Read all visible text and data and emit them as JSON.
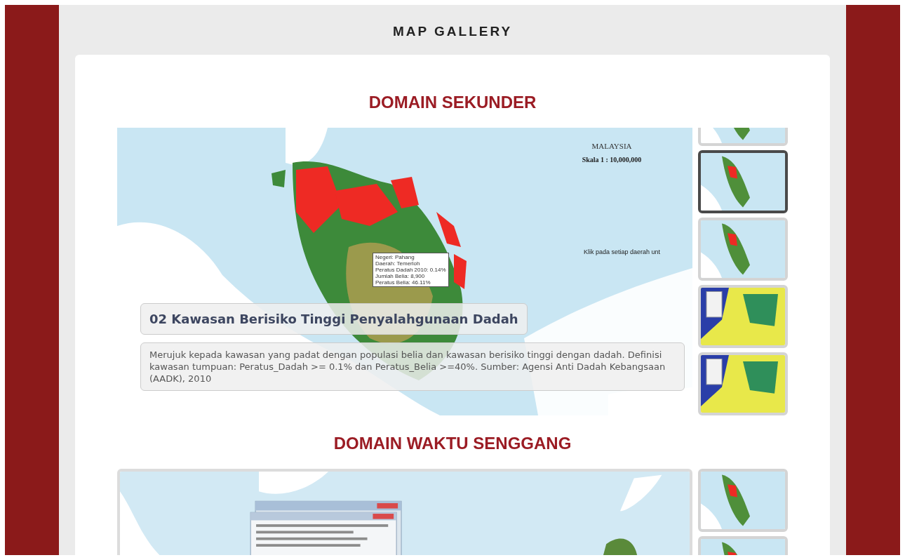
{
  "page_title": "MAP GALLERY",
  "sections": [
    {
      "heading": "DOMAIN SEKUNDER",
      "map": {
        "kind": "peninsula",
        "country": "MALAYSIA",
        "scale": "Skala 1 : 10,000,000",
        "hint": "Klik pada setiap daerah unt",
        "tooltip": [
          "Negeri: Pahang",
          "Daerah: Temerloh",
          "Peratus Dadah 2010: 0.14%",
          "Jumlah Belia: 8,900",
          "Peratus Belia: 46.11%"
        ],
        "caption_title": "02 Kawasan Berisiko Tinggi Penyalahgunaan Dadah",
        "caption_text": "Merujuk kepada kawasan yang padat dengan populasi belia dan kawasan berisiko tinggi dengan dadah. Definisi kawasan tumpuan: Peratus_Dadah >= 0.1% dan Peratus_Belia >=40%. Sumber: Agensi Anti Dadah Kebangsaan (AADK), 2010"
      },
      "thumbnails": [
        {
          "kind": "map",
          "selected": false
        },
        {
          "kind": "map",
          "selected": true
        },
        {
          "kind": "map",
          "selected": false
        },
        {
          "kind": "choropleth",
          "selected": false
        },
        {
          "kind": "choropleth",
          "selected": false
        }
      ]
    },
    {
      "heading": "DOMAIN WAKTU SENGGANG",
      "map": {
        "kind": "popup"
      },
      "thumbnails": [
        {
          "kind": "map",
          "selected": false
        },
        {
          "kind": "map",
          "selected": false
        }
      ]
    }
  ]
}
